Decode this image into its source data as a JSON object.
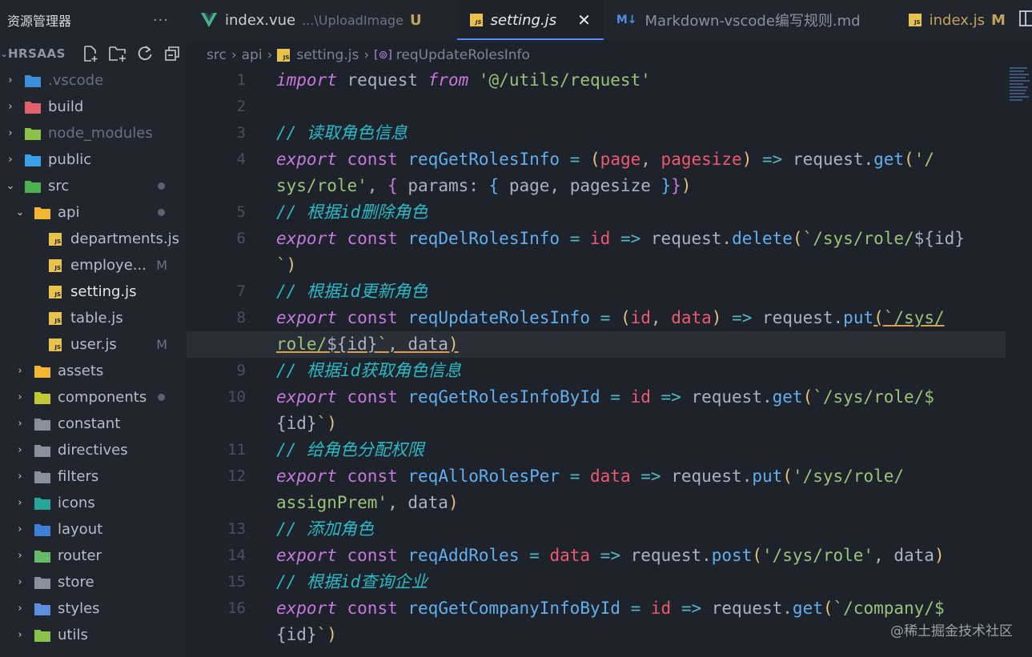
{
  "explorer": {
    "title": "资源管理器",
    "more": "···",
    "project": "HRSAAS",
    "tree": [
      {
        "label": ".vscode",
        "kind": "folder",
        "icon": "vscode-folder-icon",
        "indent": 1,
        "chev": "›",
        "dim": true
      },
      {
        "label": "build",
        "kind": "folder",
        "icon": "build-folder-icon",
        "indent": 1,
        "chev": "›"
      },
      {
        "label": "node_modules",
        "kind": "folder",
        "icon": "node-folder-icon",
        "indent": 1,
        "chev": "›",
        "dim": true
      },
      {
        "label": "public",
        "kind": "folder",
        "icon": "public-folder-icon",
        "indent": 1,
        "chev": "›"
      },
      {
        "label": "src",
        "kind": "folder",
        "icon": "src-folder-icon",
        "indent": 1,
        "chev": "⌄",
        "dot": true
      },
      {
        "label": "api",
        "kind": "folder",
        "icon": "api-folder-icon",
        "indent": 2,
        "chev": "⌄",
        "dot": true
      },
      {
        "label": "departments.js",
        "kind": "js",
        "icon": "js-file-icon",
        "indent": 3
      },
      {
        "label": "employe...",
        "kind": "js",
        "icon": "js-file-icon",
        "indent": 3,
        "mark": "M"
      },
      {
        "label": "setting.js",
        "kind": "js",
        "icon": "js-file-icon",
        "indent": 3,
        "active": true
      },
      {
        "label": "table.js",
        "kind": "js",
        "icon": "js-file-icon",
        "indent": 3
      },
      {
        "label": "user.js",
        "kind": "js",
        "icon": "js-file-icon",
        "indent": 3,
        "mark": "M"
      },
      {
        "label": "assets",
        "kind": "folder",
        "icon": "assets-folder-icon",
        "indent": 2,
        "chev": "›"
      },
      {
        "label": "components",
        "kind": "folder",
        "icon": "components-folder-icon",
        "indent": 2,
        "chev": "›",
        "dot": true
      },
      {
        "label": "constant",
        "kind": "folder",
        "icon": "folder-icon",
        "indent": 2,
        "chev": "›"
      },
      {
        "label": "directives",
        "kind": "folder",
        "icon": "folder-icon",
        "indent": 2,
        "chev": "›"
      },
      {
        "label": "filters",
        "kind": "folder",
        "icon": "folder-icon",
        "indent": 2,
        "chev": "›"
      },
      {
        "label": "icons",
        "kind": "folder",
        "icon": "icons-folder-icon",
        "indent": 2,
        "chev": "›"
      },
      {
        "label": "layout",
        "kind": "folder",
        "icon": "layout-folder-icon",
        "indent": 2,
        "chev": "›"
      },
      {
        "label": "router",
        "kind": "folder",
        "icon": "router-folder-icon",
        "indent": 2,
        "chev": "›"
      },
      {
        "label": "store",
        "kind": "folder",
        "icon": "folder-icon",
        "indent": 2,
        "chev": "›"
      },
      {
        "label": "styles",
        "kind": "folder",
        "icon": "styles-folder-icon",
        "indent": 2,
        "chev": "›"
      },
      {
        "label": "utils",
        "kind": "folder",
        "icon": "utils-folder-icon",
        "indent": 2,
        "chev": "›"
      }
    ]
  },
  "tabs": [
    {
      "label": "index.vue",
      "path": "...\\UploadImage",
      "badge": "U",
      "icon": "vue-icon"
    },
    {
      "label": "setting.js",
      "icon": "js-file-icon",
      "active": true,
      "close": "✕"
    },
    {
      "label": "Markdown-vscode编写规则.md",
      "icon": "markdown-icon",
      "iconText": "M↓"
    },
    {
      "label": "index.js",
      "badge": "M",
      "icon": "js-file-icon"
    }
  ],
  "breadcrumb": {
    "items": [
      "src",
      "api",
      "setting.js",
      "reqUpdateRolesInfo"
    ],
    "separator": "›",
    "symbol_icon": "[⊚]"
  },
  "editor": {
    "current_line": 8,
    "lines": [
      {
        "n": "1",
        "tokens": [
          [
            "kw",
            "import"
          ],
          [
            "pl",
            " request "
          ],
          [
            "kw",
            "from"
          ],
          [
            "pl",
            " "
          ],
          [
            "st",
            "'@/utils/request'"
          ]
        ]
      },
      {
        "n": "2",
        "tokens": []
      },
      {
        "n": "3",
        "tokens": [
          [
            "cm2",
            "// 读取角色信息"
          ]
        ]
      },
      {
        "n": "4",
        "tokens": [
          [
            "kw",
            "export"
          ],
          [
            "pl",
            " "
          ],
          [
            "cn",
            "const"
          ],
          [
            "pl",
            " "
          ],
          [
            "fn",
            "reqGetRolesInfo"
          ],
          [
            "pl",
            " "
          ],
          [
            "op",
            "="
          ],
          [
            "pl",
            " "
          ],
          [
            "br1",
            "("
          ],
          [
            "pm",
            "page"
          ],
          [
            "pl",
            ", "
          ],
          [
            "pm",
            "pagesize"
          ],
          [
            "br1",
            ")"
          ],
          [
            "pl",
            " "
          ],
          [
            "op",
            "=>"
          ],
          [
            "pl",
            " request."
          ],
          [
            "fn",
            "get"
          ],
          [
            "br1",
            "("
          ],
          [
            "st",
            "'/"
          ]
        ]
      },
      {
        "n": "",
        "tokens": [
          [
            "st",
            "sys/role'"
          ],
          [
            "pl",
            ", "
          ],
          [
            "br2",
            "{"
          ],
          [
            "pl",
            " params: "
          ],
          [
            "br3",
            "{"
          ],
          [
            "pl",
            " page, pagesize "
          ],
          [
            "br3",
            "}"
          ],
          [
            "br2",
            "}"
          ],
          [
            "br1",
            ")"
          ]
        ]
      },
      {
        "n": "5",
        "tokens": [
          [
            "cm2",
            "// 根据id删除角色"
          ]
        ]
      },
      {
        "n": "6",
        "tokens": [
          [
            "kw",
            "export"
          ],
          [
            "pl",
            " "
          ],
          [
            "cn",
            "const"
          ],
          [
            "pl",
            " "
          ],
          [
            "fn",
            "reqDelRolesInfo"
          ],
          [
            "pl",
            " "
          ],
          [
            "op",
            "="
          ],
          [
            "pl",
            " "
          ],
          [
            "pm",
            "id"
          ],
          [
            "pl",
            " "
          ],
          [
            "op",
            "=>"
          ],
          [
            "pl",
            " request."
          ],
          [
            "fn",
            "delete"
          ],
          [
            "br1",
            "("
          ],
          [
            "st",
            "`/sys/role/"
          ],
          [
            "pl",
            "${id}"
          ]
        ]
      },
      {
        "n": "",
        "tokens": [
          [
            "st",
            "`"
          ],
          [
            "br1",
            ")"
          ]
        ]
      },
      {
        "n": "7",
        "tokens": [
          [
            "cm2",
            "// 根据id更新角色"
          ]
        ]
      },
      {
        "n": "8",
        "tokens": [
          [
            "kw",
            "export"
          ],
          [
            "pl",
            " "
          ],
          [
            "cn",
            "const"
          ],
          [
            "pl",
            " "
          ],
          [
            "fn",
            "reqUpdateRolesInfo"
          ],
          [
            "pl",
            " "
          ],
          [
            "op",
            "="
          ],
          [
            "pl",
            " "
          ],
          [
            "br1",
            "("
          ],
          [
            "pm",
            "id"
          ],
          [
            "pl",
            ", "
          ],
          [
            "pm",
            "data"
          ],
          [
            "br1",
            ")"
          ],
          [
            "pl",
            " "
          ],
          [
            "op",
            "=>"
          ],
          [
            "pl",
            " request."
          ],
          [
            "fn",
            "put"
          ],
          [
            "br1 und",
            "("
          ],
          [
            "st und",
            "`/sys/"
          ]
        ]
      },
      {
        "n": "",
        "cur": true,
        "tokens": [
          [
            "st und",
            "role/"
          ],
          [
            "pl und",
            "${id}"
          ],
          [
            "st und",
            "`"
          ],
          [
            "pl und",
            ", data"
          ],
          [
            "br1 und",
            ")"
          ]
        ]
      },
      {
        "n": "9",
        "tokens": [
          [
            "cm2",
            "// 根据id获取角色信息"
          ]
        ]
      },
      {
        "n": "10",
        "tokens": [
          [
            "kw",
            "export"
          ],
          [
            "pl",
            " "
          ],
          [
            "cn",
            "const"
          ],
          [
            "pl",
            " "
          ],
          [
            "fn",
            "reqGetRolesInfoById"
          ],
          [
            "pl",
            " "
          ],
          [
            "op",
            "="
          ],
          [
            "pl",
            " "
          ],
          [
            "pm",
            "id"
          ],
          [
            "pl",
            " "
          ],
          [
            "op",
            "=>"
          ],
          [
            "pl",
            " request."
          ],
          [
            "fn",
            "get"
          ],
          [
            "br1",
            "("
          ],
          [
            "st",
            "`/sys/role/$"
          ]
        ]
      },
      {
        "n": "",
        "tokens": [
          [
            "pl",
            "{id}"
          ],
          [
            "st",
            "`"
          ],
          [
            "br1",
            ")"
          ]
        ]
      },
      {
        "n": "11",
        "tokens": [
          [
            "cm2",
            "// 给角色分配权限"
          ]
        ]
      },
      {
        "n": "12",
        "tokens": [
          [
            "kw",
            "export"
          ],
          [
            "pl",
            " "
          ],
          [
            "cn",
            "const"
          ],
          [
            "pl",
            " "
          ],
          [
            "fn",
            "reqAlloRolesPer"
          ],
          [
            "pl",
            " "
          ],
          [
            "op",
            "="
          ],
          [
            "pl",
            " "
          ],
          [
            "pm",
            "data"
          ],
          [
            "pl",
            " "
          ],
          [
            "op",
            "=>"
          ],
          [
            "pl",
            " request."
          ],
          [
            "fn",
            "put"
          ],
          [
            "br1",
            "("
          ],
          [
            "st",
            "'/sys/role/"
          ]
        ]
      },
      {
        "n": "",
        "tokens": [
          [
            "st",
            "assignPrem'"
          ],
          [
            "pl",
            ", data"
          ],
          [
            "br1",
            ")"
          ]
        ]
      },
      {
        "n": "13",
        "tokens": [
          [
            "cm2",
            "// 添加角色"
          ]
        ]
      },
      {
        "n": "14",
        "tokens": [
          [
            "kw",
            "export"
          ],
          [
            "pl",
            " "
          ],
          [
            "cn",
            "const"
          ],
          [
            "pl",
            " "
          ],
          [
            "fn",
            "reqAddRoles"
          ],
          [
            "pl",
            " "
          ],
          [
            "op",
            "="
          ],
          [
            "pl",
            " "
          ],
          [
            "pm",
            "data"
          ],
          [
            "pl",
            " "
          ],
          [
            "op",
            "=>"
          ],
          [
            "pl",
            " request."
          ],
          [
            "fn",
            "post"
          ],
          [
            "br1",
            "("
          ],
          [
            "st",
            "'/sys/role'"
          ],
          [
            "pl",
            ", data"
          ],
          [
            "br1",
            ")"
          ]
        ]
      },
      {
        "n": "15",
        "tokens": [
          [
            "cm2",
            "// 根据id查询企业"
          ]
        ]
      },
      {
        "n": "16",
        "tokens": [
          [
            "kw",
            "export"
          ],
          [
            "pl",
            " "
          ],
          [
            "cn",
            "const"
          ],
          [
            "pl",
            " "
          ],
          [
            "fn",
            "reqGetCompanyInfoById"
          ],
          [
            "pl",
            " "
          ],
          [
            "op",
            "="
          ],
          [
            "pl",
            " "
          ],
          [
            "pm",
            "id"
          ],
          [
            "pl",
            " "
          ],
          [
            "op",
            "=>"
          ],
          [
            "pl",
            " request."
          ],
          [
            "fn",
            "get"
          ],
          [
            "br1",
            "("
          ],
          [
            "st",
            "`/company/$"
          ]
        ]
      },
      {
        "n": "",
        "tokens": [
          [
            "pl",
            "{id}"
          ],
          [
            "st",
            "`"
          ],
          [
            "br1",
            ")"
          ]
        ]
      }
    ]
  },
  "watermark": "@稀土掘金技术社区",
  "colors": {
    "accent": "#528bff",
    "js_badge": "#e8c24a",
    "modified": "#c2a35a"
  }
}
